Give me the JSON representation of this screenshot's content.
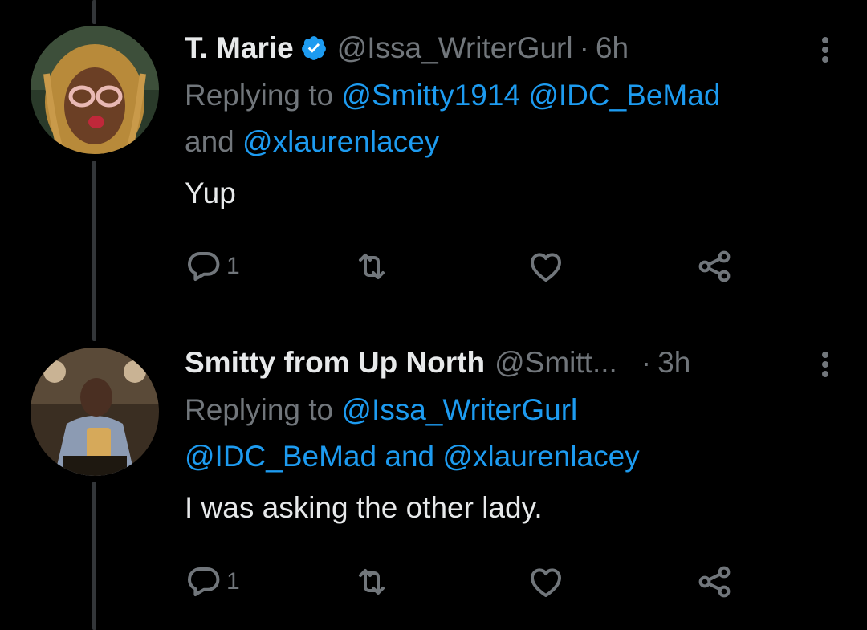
{
  "tweets": [
    {
      "display_name": "T. Marie",
      "verified": true,
      "handle": "@Issa_WriterGurl",
      "separator": "·",
      "time": "6h",
      "replying_prefix": "Replying to ",
      "replying_line1_mentions": "@Smitty1914 @IDC_BeMad",
      "replying_and": "and ",
      "replying_line2_mention": "@xlaurenlacey",
      "text": "Yup",
      "reply_count": "1",
      "avatar_icon": "avatar-photo"
    },
    {
      "display_name": "Smitty from Up North",
      "verified": false,
      "handle": "@Smitt...",
      "separator": "·",
      "time": "3h",
      "replying_prefix": "Replying to ",
      "replying_line1_mention": "@Issa_WriterGurl",
      "replying_line2_mention_a": "@IDC_BeMad",
      "replying_and": " and ",
      "replying_line2_mention_b": "@xlaurenlacey",
      "text": "I was asking the other lady.",
      "reply_count": "1",
      "avatar_icon": "avatar-photo"
    }
  ],
  "icons": {
    "reply": "reply-icon",
    "retweet": "retweet-icon",
    "like": "like-icon",
    "share": "share-icon",
    "more": "more-icon",
    "verified": "verified-badge-icon"
  },
  "colors": {
    "background": "#000000",
    "primary_text": "#e7e9ea",
    "secondary_text": "#71767b",
    "accent": "#1d9bf0",
    "thread_line": "#333639"
  }
}
